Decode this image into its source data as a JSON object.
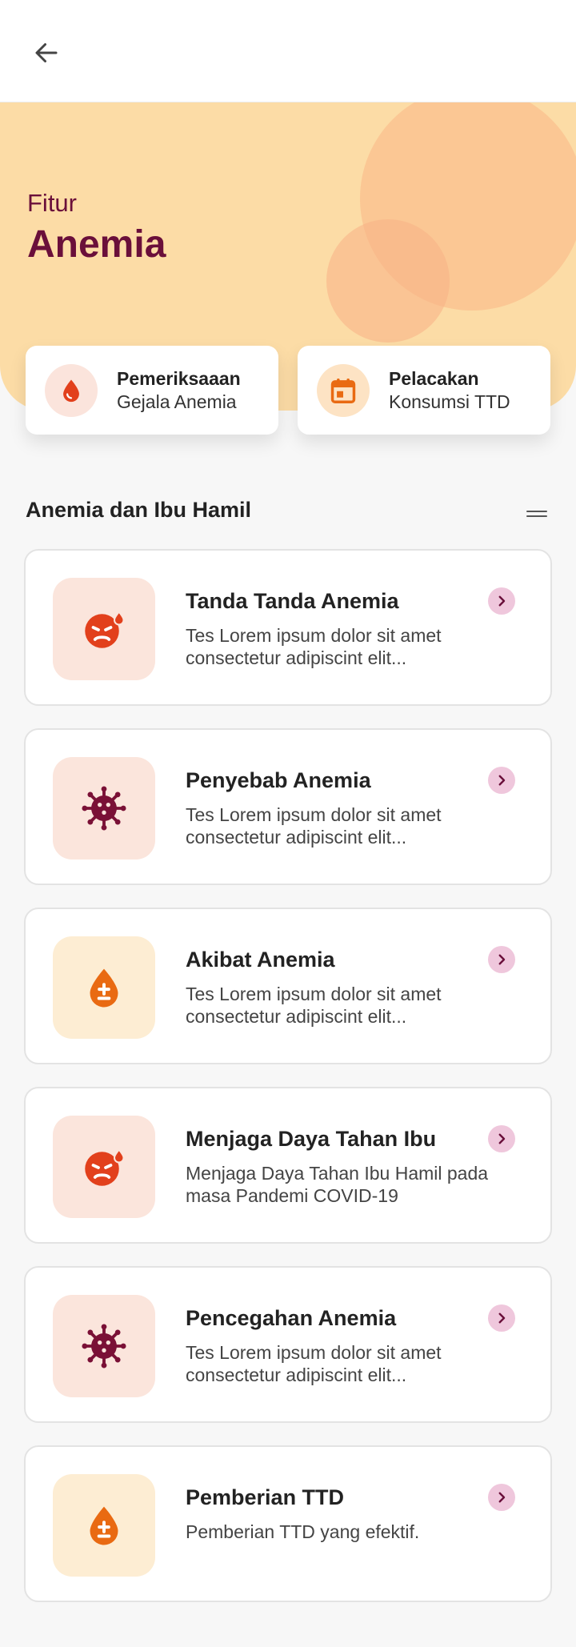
{
  "hero": {
    "subtitle": "Fitur",
    "title": "Anemia"
  },
  "features": [
    {
      "title": "Pemeriksaaan",
      "subtitle": "Gejala Anemia",
      "icon": "blood-drop-icon"
    },
    {
      "title": "Pelacakan",
      "subtitle": "Konsumsi TTD",
      "icon": "calendar-icon"
    }
  ],
  "section": {
    "title": "Anemia dan Ibu Hamil"
  },
  "items": [
    {
      "title": "Tanda Tanda Anemia",
      "description": "Tes Lorem ipsum dolor sit amet consectetur adipiscint elit...",
      "icon": "sick-face-icon"
    },
    {
      "title": "Penyebab Anemia",
      "description": "Tes Lorem ipsum dolor sit amet consectetur adipiscint elit...",
      "icon": "virus-icon"
    },
    {
      "title": "Akibat Anemia",
      "description": "Tes Lorem ipsum dolor sit amet consectetur adipiscint elit...",
      "icon": "blood-drop-plus-minus-icon"
    },
    {
      "title": "Menjaga Daya Tahan Ibu",
      "description": "Menjaga Daya Tahan Ibu Hamil pada masa Pandemi COVID-19",
      "icon": "sick-face-icon"
    },
    {
      "title": "Pencegahan Anemia",
      "description": "Tes Lorem ipsum dolor sit amet consectetur adipiscint elit...",
      "icon": "virus-icon"
    },
    {
      "title": "Pemberian TTD",
      "description": "Pemberian TTD yang efektif.",
      "icon": "blood-drop-plus-minus-icon"
    }
  ],
  "colors": {
    "hero_background": "#fcdca6",
    "brand_maroon": "#6a0f3a",
    "icon_red": "#e2401c",
    "icon_orange": "#e96a12",
    "chevron_background": "#efc7dc"
  }
}
